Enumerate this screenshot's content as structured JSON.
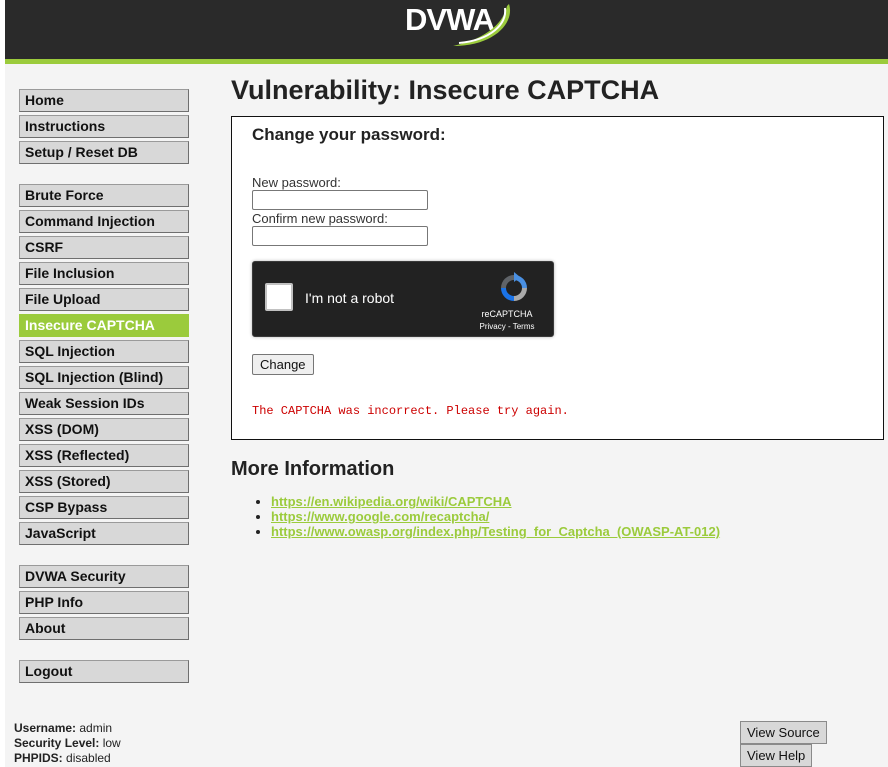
{
  "header": {
    "logo_text": "DVWA",
    "accent_color": "#9bcb3c"
  },
  "menu": {
    "group1": [
      {
        "label": "Home"
      },
      {
        "label": "Instructions"
      },
      {
        "label": "Setup / Reset DB"
      }
    ],
    "group2": [
      {
        "label": "Brute Force"
      },
      {
        "label": "Command Injection"
      },
      {
        "label": "CSRF"
      },
      {
        "label": "File Inclusion"
      },
      {
        "label": "File Upload"
      },
      {
        "label": "Insecure CAPTCHA",
        "selected": true
      },
      {
        "label": "SQL Injection"
      },
      {
        "label": "SQL Injection (Blind)"
      },
      {
        "label": "Weak Session IDs"
      },
      {
        "label": "XSS (DOM)"
      },
      {
        "label": "XSS (Reflected)"
      },
      {
        "label": "XSS (Stored)"
      },
      {
        "label": "CSP Bypass"
      },
      {
        "label": "JavaScript"
      }
    ],
    "group3": [
      {
        "label": "DVWA Security"
      },
      {
        "label": "PHP Info"
      },
      {
        "label": "About"
      }
    ],
    "group4": [
      {
        "label": "Logout"
      }
    ]
  },
  "main": {
    "title": "Vulnerability: Insecure CAPTCHA",
    "form": {
      "title": "Change your password:",
      "new_password_label": "New password:",
      "new_password_value": "",
      "confirm_password_label": "Confirm new password:",
      "confirm_password_value": "",
      "recaptcha": {
        "label": "I'm not a robot",
        "brand": "reCAPTCHA",
        "privacy": "Privacy",
        "separator": " - ",
        "terms": "Terms",
        "checked": false
      },
      "change_button": "Change",
      "error": "The CAPTCHA was incorrect. Please try again.",
      "error_color": "#cc0000"
    },
    "more_info": {
      "title": "More Information",
      "links": [
        "https://en.wikipedia.org/wiki/CAPTCHA",
        "https://www.google.com/recaptcha/",
        "https://www.owasp.org/index.php/Testing_for_Captcha_(OWASP-AT-012)"
      ]
    }
  },
  "user_info": {
    "username_label": "Username:",
    "username": "admin",
    "security_label": "Security Level:",
    "security": "low",
    "phpids_label": "PHPIDS:",
    "phpids": "disabled"
  },
  "footer": {
    "view_source": "View Source",
    "view_help": "View Help"
  }
}
